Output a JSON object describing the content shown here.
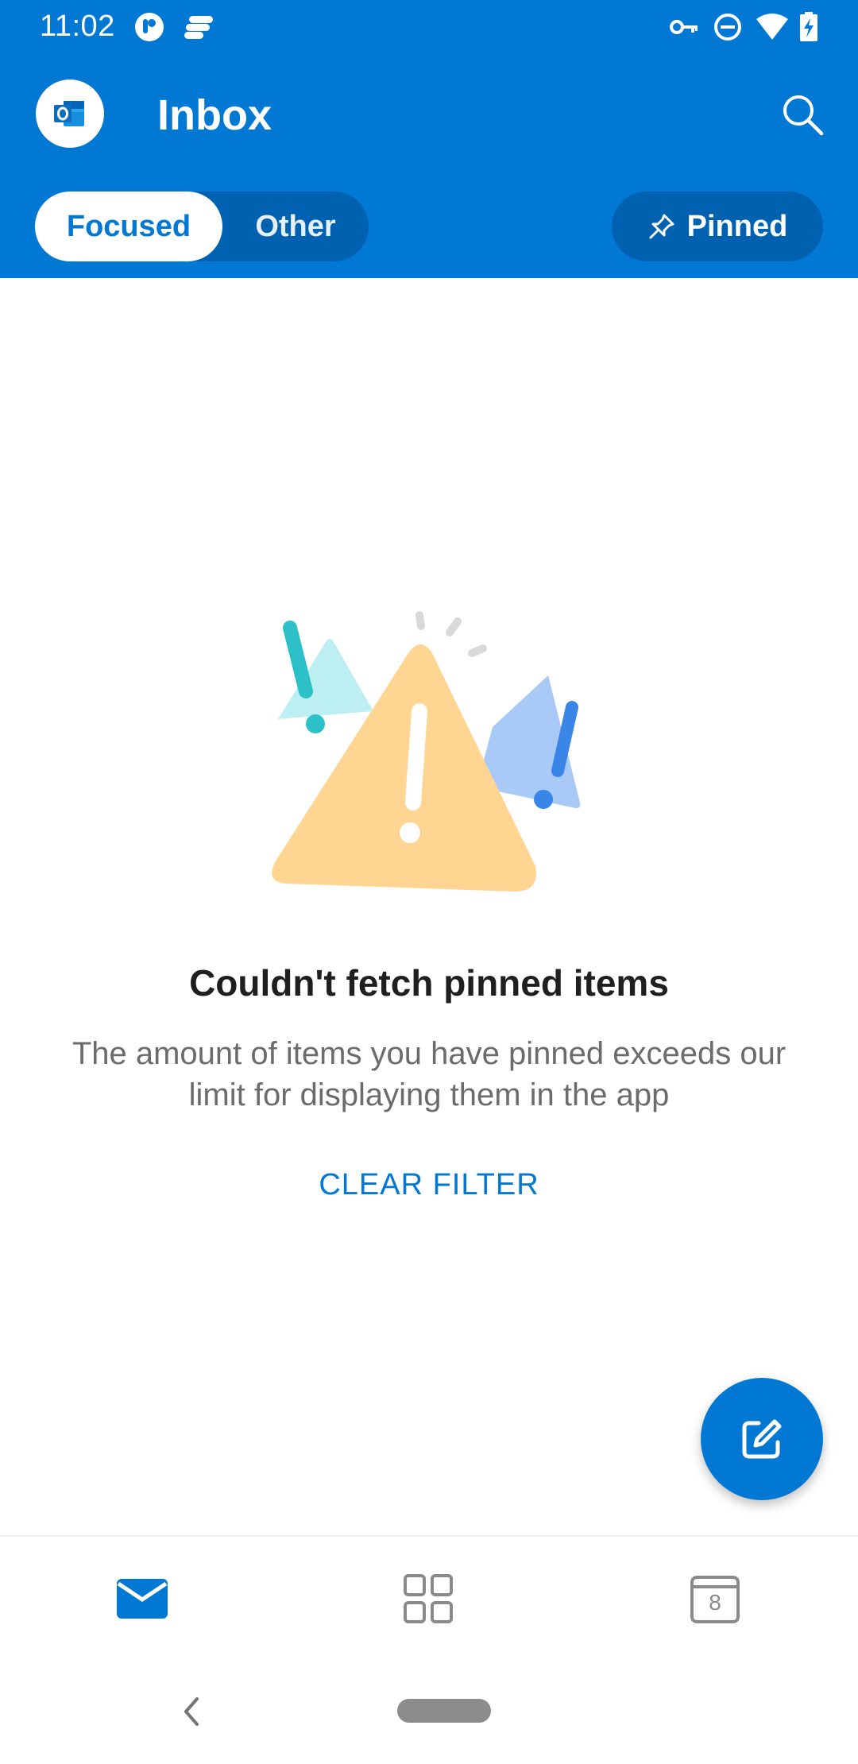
{
  "status_bar": {
    "time": "11:02"
  },
  "header": {
    "title": "Inbox",
    "tabs": [
      {
        "label": "Focused",
        "selected": true
      },
      {
        "label": "Other",
        "selected": false
      }
    ],
    "pinned_label": "Pinned"
  },
  "empty_state": {
    "title": "Couldn't fetch pinned items",
    "description": "The amount of items you have pinned exceeds our limit for displaying them in the app",
    "action_label": "CLEAR FILTER"
  },
  "icons": {
    "status_left": [
      "app-notification-icon",
      "app-notification-icon"
    ],
    "status_right": [
      "vpn-key-icon",
      "do-not-disturb-icon",
      "wifi-icon",
      "battery-charging-icon"
    ],
    "header": [
      "outlook-logo-icon",
      "search-icon",
      "pin-icon"
    ],
    "fab": "compose-icon",
    "bottom_nav": [
      "mail-icon",
      "apps-icon",
      "calendar-icon"
    ]
  },
  "bottom_nav": {
    "calendar_day": "8",
    "active": "mail"
  },
  "colors": {
    "brand": "#0078d4",
    "brand_dark": "#0061b0",
    "warning_yellow": "#ffd591",
    "accent_teal": "#2cc0c8",
    "accent_blue": "#3a86e8"
  }
}
